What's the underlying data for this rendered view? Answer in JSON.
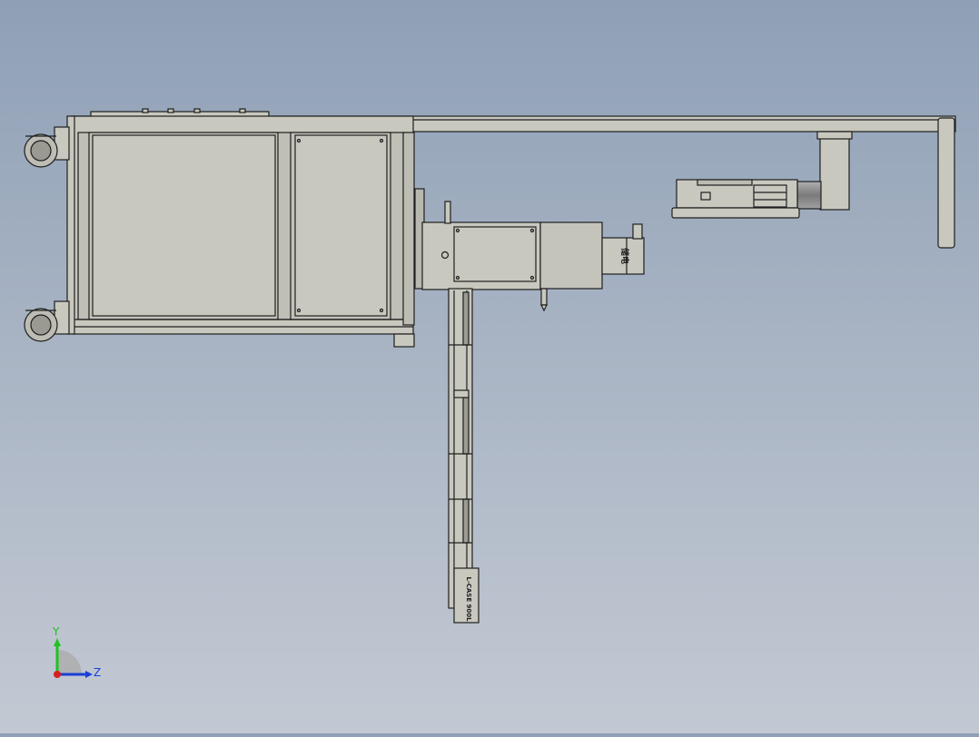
{
  "drawing": {
    "part_label_motor_1": "储电",
    "part_label_motor_2": "L-CASE 900L"
  },
  "triad": {
    "y_label": "Y",
    "z_label": "Z",
    "colors": {
      "y": "#1fc21f",
      "z": "#1a3fd6",
      "x": "#d42020"
    }
  },
  "colors": {
    "background_top": "#8fa0b6",
    "background_bottom": "#c3c9d3",
    "part_fill": "#c8c8bf",
    "part_fill_dark": "#b4b4aa",
    "edge": "#1e1e1e",
    "motor_gray": "#8e8e8e"
  }
}
